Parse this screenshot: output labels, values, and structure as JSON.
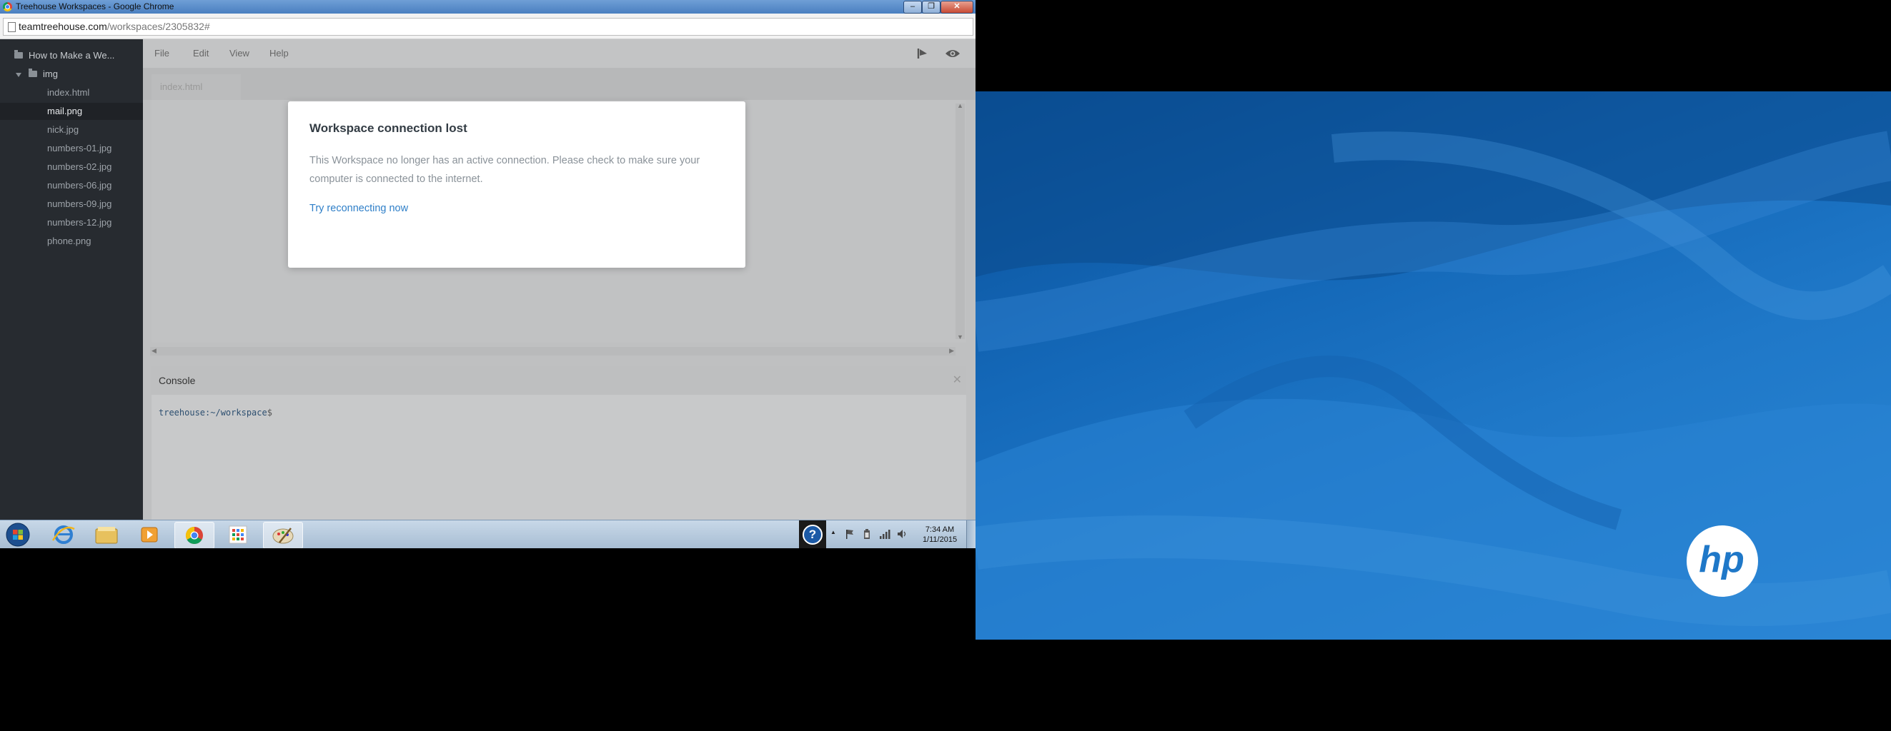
{
  "window": {
    "title": "Treehouse Workspaces - Google Chrome",
    "min_label": "–",
    "max_label": "❐",
    "close_label": "✕"
  },
  "address": {
    "domain": "teamtreehouse.com",
    "path": "/workspaces/2305832#"
  },
  "sidebar": {
    "project": "How to Make a We...",
    "folder": "img",
    "files": [
      "index.html",
      "mail.png",
      "nick.jpg",
      "numbers-01.jpg",
      "numbers-02.jpg",
      "numbers-06.jpg",
      "numbers-09.jpg",
      "numbers-12.jpg",
      "phone.png"
    ],
    "selected": "mail.png"
  },
  "menu": {
    "file": "File",
    "edit": "Edit",
    "view": "View",
    "help": "Help"
  },
  "editor": {
    "tab": "index.html"
  },
  "console": {
    "title": "Console",
    "close": "✕",
    "prompt_path": "treehouse:~/workspace",
    "prompt_symbol": "$"
  },
  "modal": {
    "title": "Workspace connection lost",
    "body": "This Workspace no longer has an active connection. Please check to make sure your computer is connected to the internet.",
    "link": "Try reconnecting now"
  },
  "taskbar": {
    "time": "7:34 AM",
    "date": "1/11/2015",
    "tray_help": "?",
    "tray_expand": "▲"
  },
  "wallpaper": {
    "logo": "hp"
  },
  "colors": {
    "link": "#2f7fc8",
    "sidebar_bg": "#272b30",
    "wallpaper_blue": "#1f78c8"
  }
}
